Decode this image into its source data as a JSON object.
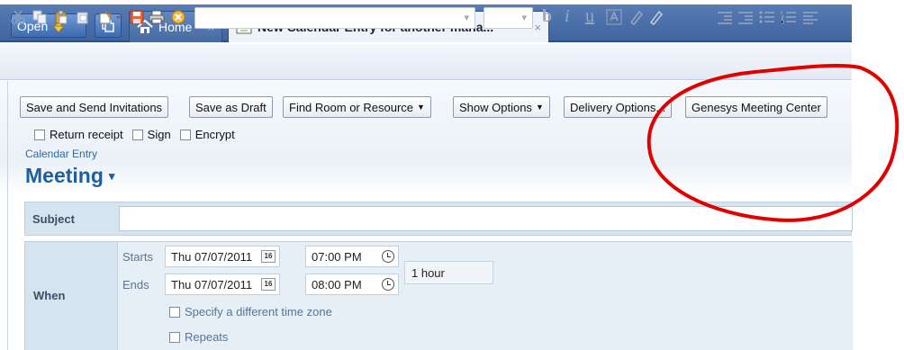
{
  "tabs": {
    "open_label": "Open",
    "home_label": "Home",
    "calendar_label": "New Calendar Entry for another mana...",
    "close_glyph": "×"
  },
  "toolbar": {
    "font_select_value": "",
    "size_select_value": "",
    "format_glyphs": [
      "b",
      "i",
      "u"
    ]
  },
  "actions": {
    "save_send": "Save and Send Invitations",
    "save_draft": "Save as Draft",
    "find_room": "Find Room or Resource",
    "show_options": "Show Options",
    "delivery_options": "Delivery Options...",
    "genesys": "Genesys Meeting Center",
    "dropdown_glyph": "▼"
  },
  "options": {
    "return_receipt": "Return receipt",
    "sign": "Sign",
    "encrypt": "Encrypt"
  },
  "entry": {
    "type_label": "Calendar Entry",
    "title": "Meeting",
    "title_dropdown": "▾"
  },
  "form": {
    "subject_label": "Subject",
    "subject_value": "",
    "when_label": "When",
    "starts_label": "Starts",
    "ends_label": "Ends",
    "start_date": "Thu 07/07/2011",
    "start_time": "07:00 PM",
    "end_date": "Thu 07/07/2011",
    "end_time": "08:00 PM",
    "duration": "1 hour",
    "date_picker_glyph": "16",
    "timezone_option": "Specify a different time zone",
    "repeats_option": "Repeats"
  },
  "colors": {
    "tabbar_blue": "#3f649f",
    "title_blue": "#1f5f9e",
    "annotation_red": "#e00000"
  }
}
